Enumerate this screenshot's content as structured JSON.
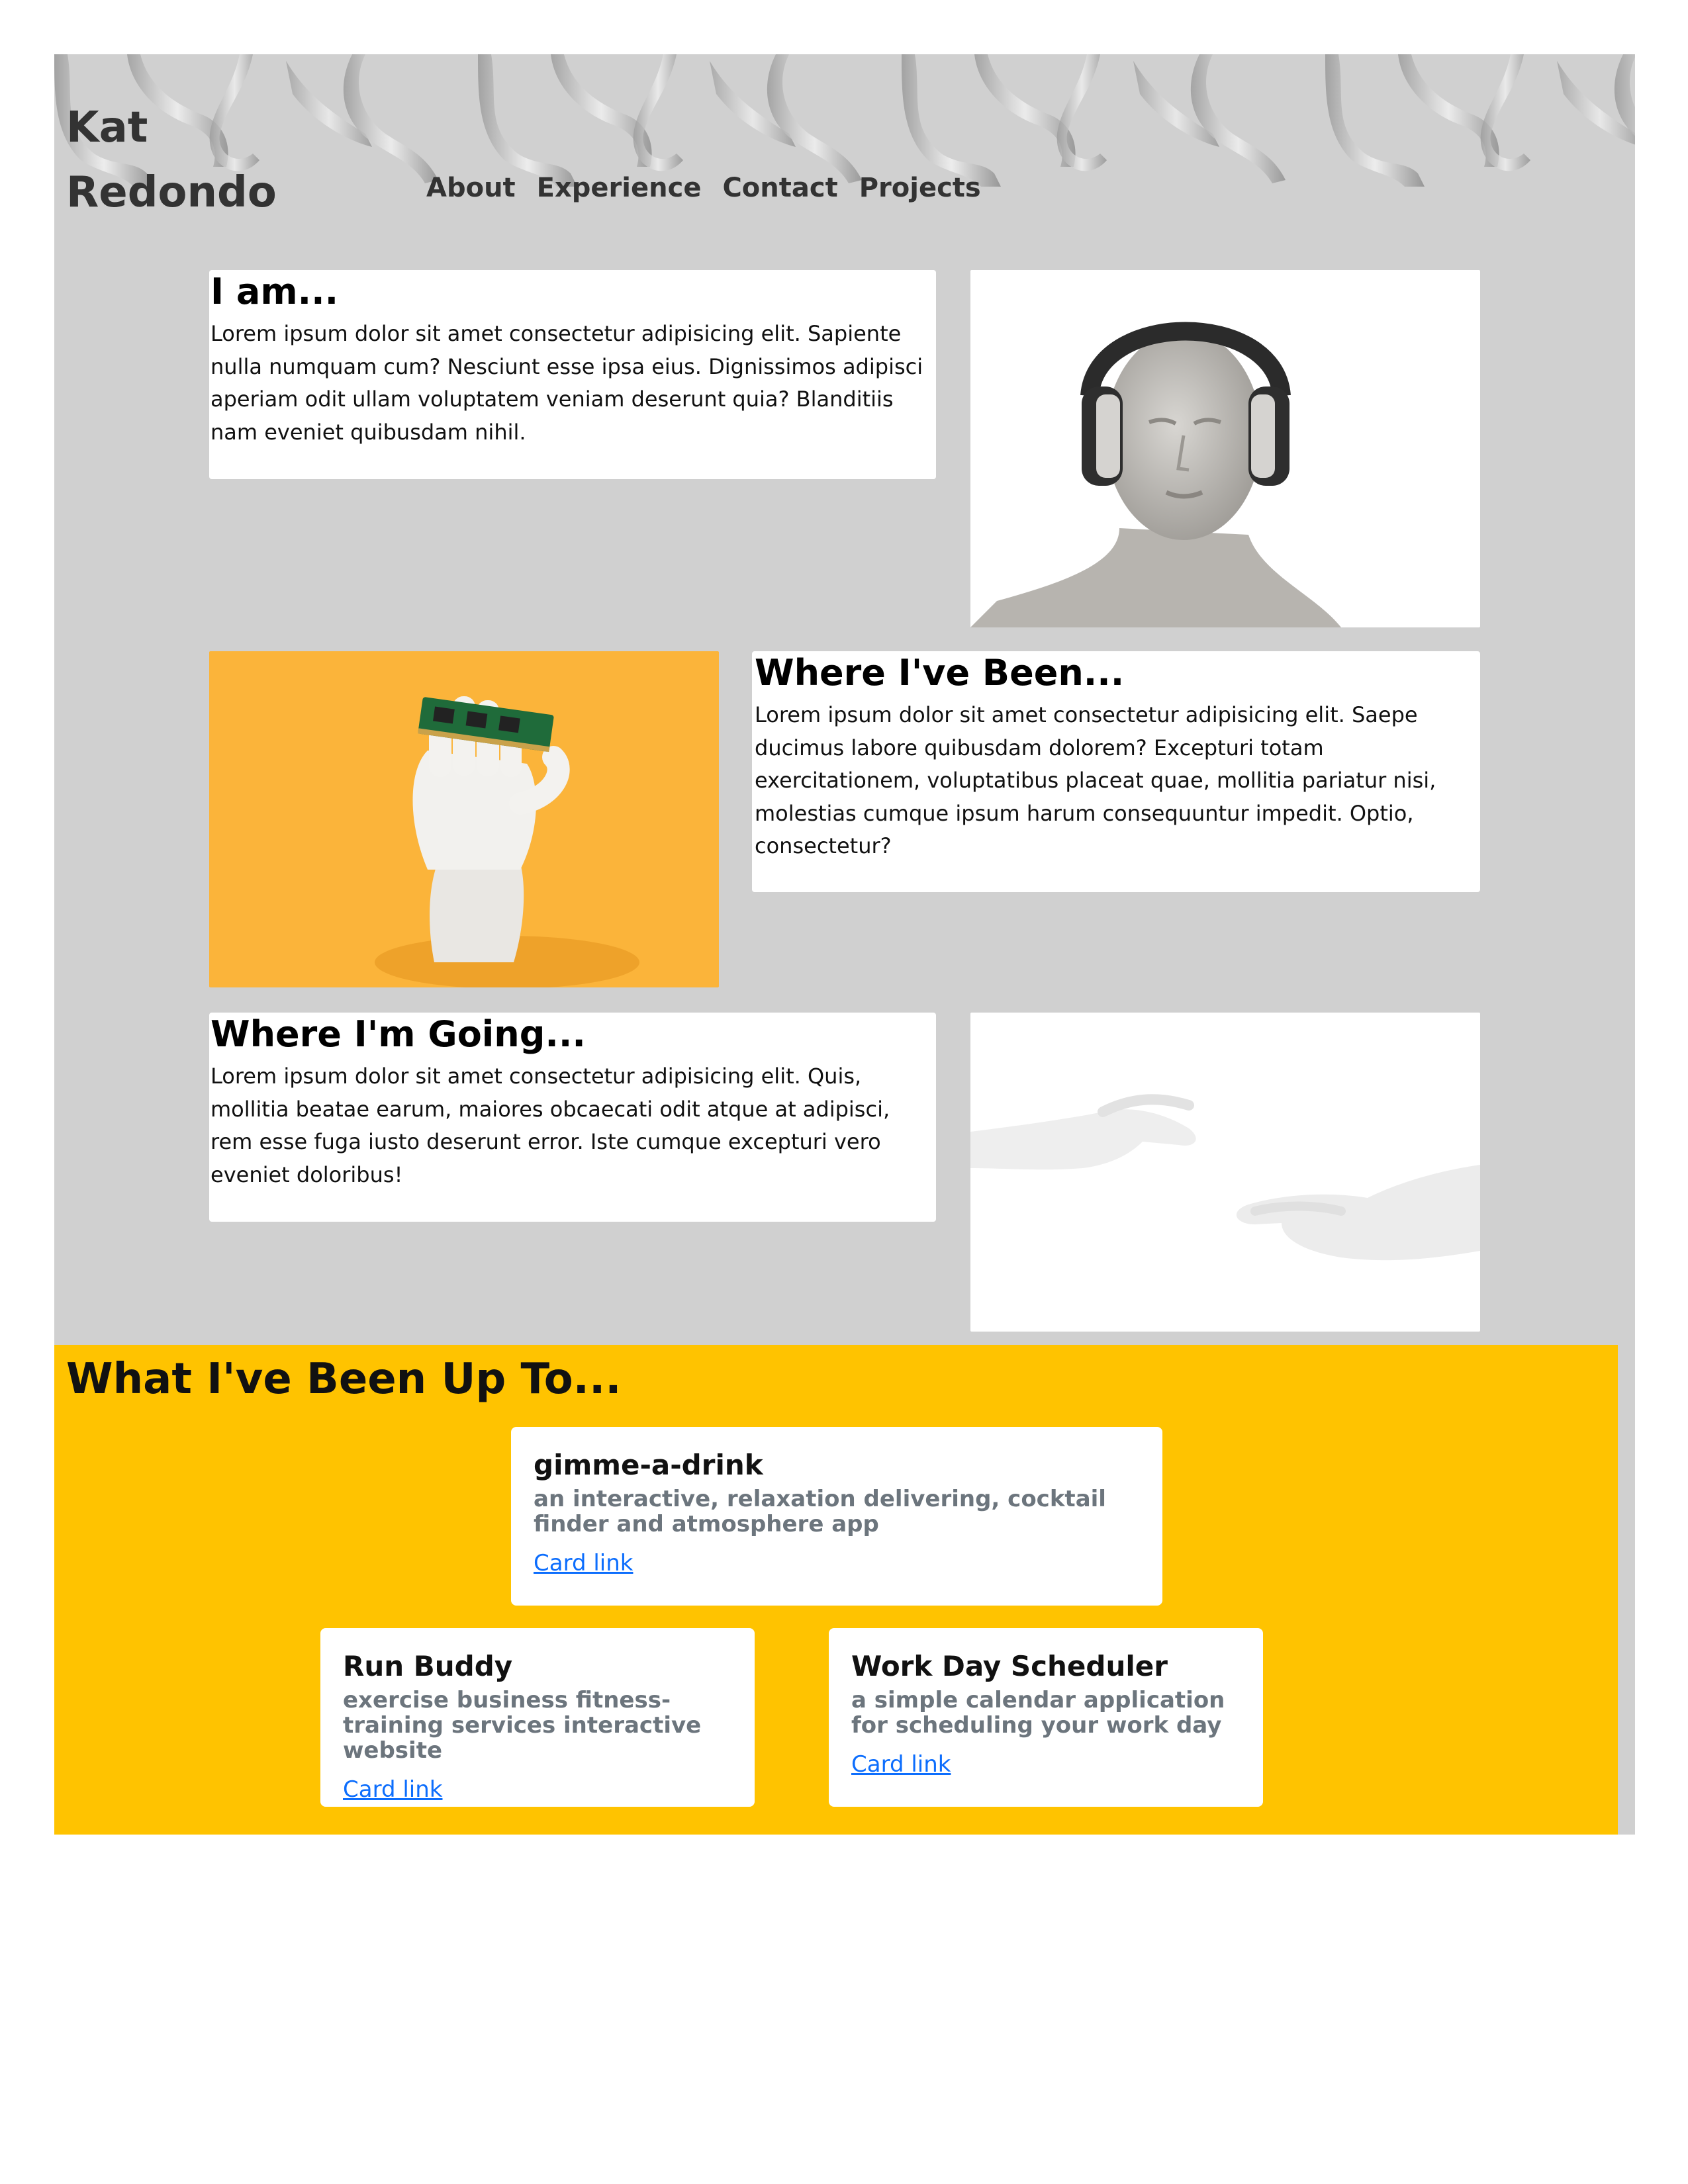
{
  "header": {
    "brand": "Kat Redondo",
    "nav": [
      "About",
      "Experience",
      "Contact",
      "Projects"
    ]
  },
  "sections": [
    {
      "heading": "I am...",
      "body": "Lorem ipsum dolor sit amet consectetur adipisicing elit. Sapiente nulla numquam cum? Nesciunt esse ipsa eius. Dignissimos adipisci aperiam odit ullam voluptatem veniam deserunt quia? Blanditiis nam eveniet quibusdam nihil."
    },
    {
      "heading": "Where I've Been...",
      "body": "Lorem ipsum dolor sit amet consectetur adipisicing elit. Saepe ducimus labore quibusdam dolorem? Excepturi totam exercitationem, voluptatibus placeat quae, mollitia pariatur nisi, molestias cumque ipsum harum consequuntur impedit. Optio, consectetur?"
    },
    {
      "heading": "Where I'm Going...",
      "body": "Lorem ipsum dolor sit amet consectetur adipisicing elit. Quis, mollitia beatae earum, maiores obcaecati odit atque at adipisci, rem esse fuga iusto deserunt error. Iste cumque excepturi vero eveniet doloribus!"
    }
  ],
  "projects": {
    "title": "What I've Been Up To...",
    "cards": [
      {
        "title": "gimme-a-drink",
        "subtitle": "an interactive, relaxation delivering, cocktail finder and atmosphere app",
        "link": "Card link"
      },
      {
        "title": "Run Buddy",
        "subtitle": "exercise business fitness-training services interactive website",
        "link": "Card link"
      },
      {
        "title": "Work Day Scheduler",
        "subtitle": "a simple calendar application for scheduling your work day",
        "link": "Card link"
      }
    ]
  },
  "colors": {
    "page_background": "#d0d0d0",
    "projects_background": "#ffc300",
    "card_link": "#0d6efd",
    "card_subtitle": "#6c757d"
  },
  "icons": {
    "banner": "mannequin-hands-pattern",
    "photo_1": "mannequin-with-headphones",
    "photo_2": "mannequin-hand-holding-ram-chip",
    "photo_3": "mannequin-hands-reaching"
  }
}
